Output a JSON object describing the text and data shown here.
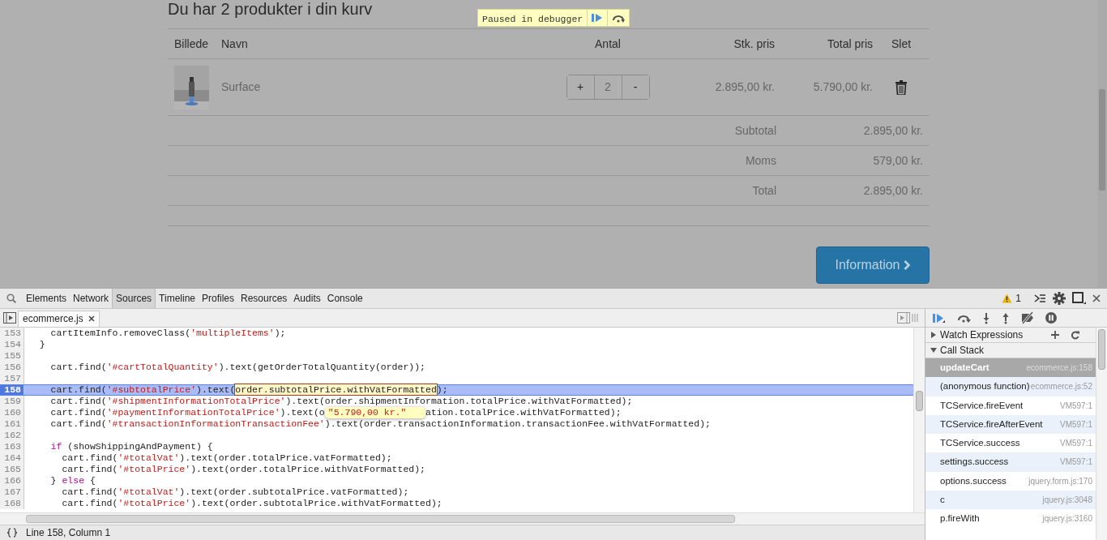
{
  "cart": {
    "title": "Du har 2 produkter i din kurv",
    "columns": [
      "Billede",
      "Navn",
      "Antal",
      "Stk. pris",
      "Total pris",
      "Slet"
    ],
    "items": [
      {
        "name": "Surface",
        "plus": "+",
        "quantity": "2",
        "minus": "-",
        "unit_price": "2.895,00 kr.",
        "total_price": "5.790,00 kr."
      }
    ],
    "summary": [
      {
        "label": "Subtotal",
        "value": "2.895,00 kr."
      },
      {
        "label": "Moms",
        "value": "579,00 kr."
      },
      {
        "label": "Total",
        "value": "2.895,00 kr."
      }
    ],
    "next_button": "Information"
  },
  "debugger_banner": {
    "text": "Paused in debugger"
  },
  "devtools": {
    "tabs": [
      {
        "label": "Elements",
        "selected": false
      },
      {
        "label": "Network",
        "selected": false
      },
      {
        "label": "Sources",
        "selected": true
      },
      {
        "label": "Timeline",
        "selected": false
      },
      {
        "label": "Profiles",
        "selected": false
      },
      {
        "label": "Resources",
        "selected": false
      },
      {
        "label": "Audits",
        "selected": false
      },
      {
        "label": "Console",
        "selected": false
      }
    ],
    "warning_count": "1",
    "open_file": "ecommerce.js",
    "debugger_toggle_disabled": true,
    "code": [
      {
        "number": "153",
        "current": false,
        "tokens": [
          {
            "kind": "plain",
            "text": "    cartItemInfo.removeClass("
          },
          {
            "kind": "string",
            "text": "'multipleItems'"
          },
          {
            "kind": "plain",
            "text": ");"
          }
        ]
      },
      {
        "number": "154",
        "current": false,
        "tokens": [
          {
            "kind": "plain",
            "text": "  }"
          }
        ]
      },
      {
        "number": "155",
        "current": false
      },
      {
        "number": "156",
        "current": false,
        "tokens": [
          {
            "kind": "plain",
            "text": "    cart.find("
          },
          {
            "kind": "string",
            "text": "'#cartTotalQuantity'"
          },
          {
            "kind": "plain",
            "text": ").text(getOrderTotalQuantity(order));"
          }
        ]
      },
      {
        "number": "157",
        "current": false
      },
      {
        "number": "158",
        "current": true,
        "tokens": [
          {
            "kind": "plain",
            "text": "    cart.find("
          },
          {
            "kind": "string",
            "text": "'#subtotalPrice'"
          },
          {
            "kind": "plain",
            "text": ").text("
          },
          {
            "kind": "inspected",
            "text": "order.subtotalPrice.withVatFormatted"
          },
          {
            "kind": "plain",
            "text": ");"
          }
        ]
      },
      {
        "number": "159",
        "current": false,
        "tokens": [
          {
            "kind": "plain",
            "text": "    cart.find("
          },
          {
            "kind": "string",
            "text": "'#shipmentInformationTotalPrice'"
          },
          {
            "kind": "plain",
            "text": ").text(order.shipmentInformation.totalPrice.withVatFormatted);"
          }
        ]
      },
      {
        "number": "160",
        "current": false,
        "tokens": [
          {
            "kind": "plain",
            "text": "    cart.find("
          },
          {
            "kind": "string",
            "text": "'#paymentInformationTotalPrice'"
          },
          {
            "kind": "plain",
            "text": ").text(o"
          },
          {
            "kind": "popover",
            "text": "\"5.790,00 kr.\""
          },
          {
            "kind": "plain",
            "text": "ation.totalPrice.withVatFormatted);"
          }
        ]
      },
      {
        "number": "161",
        "current": false,
        "tokens": [
          {
            "kind": "plain",
            "text": "    cart.find("
          },
          {
            "kind": "string",
            "text": "'#transactionInformationTransactionFee'"
          },
          {
            "kind": "plain",
            "text": ").text(order.transactionInformation.transactionFee.withVatFormatted);"
          }
        ]
      },
      {
        "number": "162",
        "current": false
      },
      {
        "number": "163",
        "current": false,
        "tokens": [
          {
            "kind": "keyword",
            "text": "    if"
          },
          {
            "kind": "plain",
            "text": " (showShippingAndPayment) {"
          }
        ]
      },
      {
        "number": "164",
        "current": false,
        "tokens": [
          {
            "kind": "plain",
            "text": "      cart.find("
          },
          {
            "kind": "string",
            "text": "'#totalVat'"
          },
          {
            "kind": "plain",
            "text": ").text(order.totalPrice.vatFormatted);"
          }
        ]
      },
      {
        "number": "165",
        "current": false,
        "tokens": [
          {
            "kind": "plain",
            "text": "      cart.find("
          },
          {
            "kind": "string",
            "text": "'#totalPrice'"
          },
          {
            "kind": "plain",
            "text": ").text(order.totalPrice.withVatFormatted);"
          }
        ]
      },
      {
        "number": "166",
        "current": false,
        "tokens": [
          {
            "kind": "plain",
            "text": "    } "
          },
          {
            "kind": "keyword",
            "text": "else"
          },
          {
            "kind": "plain",
            "text": " {"
          }
        ]
      },
      {
        "number": "167",
        "current": false,
        "tokens": [
          {
            "kind": "plain",
            "text": "      cart.find("
          },
          {
            "kind": "string",
            "text": "'#totalVat'"
          },
          {
            "kind": "plain",
            "text": ").text(order.subtotalPrice.vatFormatted);"
          }
        ]
      },
      {
        "number": "168",
        "current": false,
        "tokens": [
          {
            "kind": "plain",
            "text": "      cart.find("
          },
          {
            "kind": "string",
            "text": "'#totalPrice'"
          },
          {
            "kind": "plain",
            "text": ").text(order.subtotalPrice.withVatFormatted);"
          }
        ]
      }
    ],
    "status": "Line 158, Column 1",
    "sections": [
      {
        "label": "Watch Expressions",
        "expanded": false
      },
      {
        "label": "Call Stack",
        "expanded": true
      }
    ],
    "call_stack": [
      {
        "name": "updateCart",
        "location": "ecommerce.js:158",
        "selected": true
      },
      {
        "name": "(anonymous function)",
        "location": "ecommerce.js:52",
        "selected": false
      },
      {
        "name": "TCService.fireEvent",
        "location": "VM597:1",
        "selected": false
      },
      {
        "name": "TCService.fireAfterEvent",
        "location": "VM597:1",
        "selected": false
      },
      {
        "name": "TCService.success",
        "location": "VM597:1",
        "selected": false
      },
      {
        "name": "settings.success",
        "location": "VM597:1",
        "selected": false
      },
      {
        "name": "options.success",
        "location": "jquery.form.js:170",
        "selected": false
      },
      {
        "name": "c",
        "location": "jquery.js:3048",
        "selected": false
      },
      {
        "name": "p.fireWith",
        "location": "jquery.js:3160",
        "selected": false
      }
    ]
  }
}
